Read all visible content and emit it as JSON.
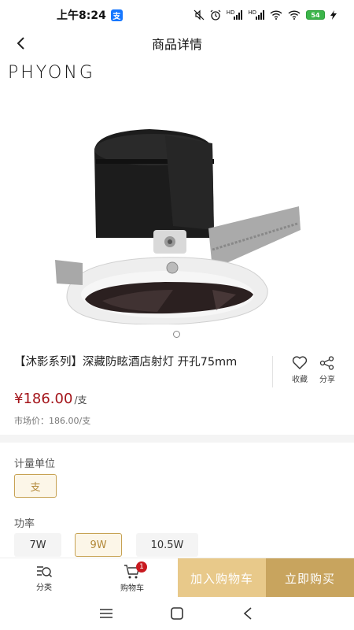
{
  "status_bar": {
    "time": "上午8:24",
    "pay_badge": "支",
    "battery": "54"
  },
  "header": {
    "title": "商品详情"
  },
  "gallery": {
    "brand": "PHYONG"
  },
  "product": {
    "title": "【沐影系列】深藏防眩酒店射灯 开孔75mm",
    "price": "¥186.00",
    "price_unit": "/支",
    "market_price": "市场价：186.00/支",
    "favorite_label": "收藏",
    "share_label": "分享"
  },
  "specs": {
    "unit_label": "计量单位",
    "unit_options": [
      "支"
    ],
    "unit_selected": "支",
    "power_label": "功率",
    "power_options": [
      "7W",
      "9W",
      "10.5W"
    ],
    "power_selected": "9W"
  },
  "bottom_bar": {
    "category_label": "分类",
    "cart_label": "购物车",
    "cart_count": "1",
    "add_to_cart": "加入购物车",
    "buy_now": "立即购买"
  },
  "colors": {
    "accent_gold": "#c8a45e",
    "light_gold": "#e8c98a",
    "price_red": "#a4151b",
    "badge_red": "#c8191f"
  }
}
